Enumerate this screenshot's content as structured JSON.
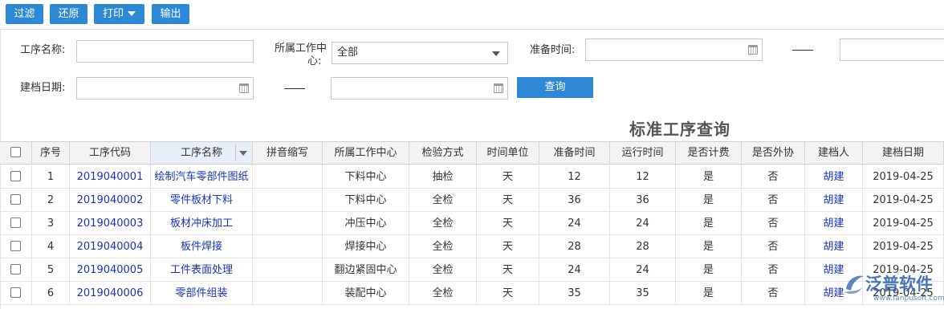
{
  "toolbar": {
    "filter": "过滤",
    "restore": "还原",
    "print": "打印",
    "export": "输出"
  },
  "filters": {
    "process_name_label": "工序名称:",
    "process_name_value": "",
    "work_center_label_1": "所属工作中",
    "work_center_label_2": "心:",
    "work_center_value": "全部",
    "prep_time_label": "准备时间:",
    "file_date_label": "建档日期:",
    "query": "查询"
  },
  "title": "标准工序查询",
  "table": {
    "headers": [
      "序号",
      "工序代码",
      "工序名称",
      "拼音缩写",
      "所属工作中心",
      "检验方式",
      "时间单位",
      "准备时间",
      "运行时间",
      "是否计费",
      "是否外协",
      "建档人",
      "建档日期"
    ],
    "rows": [
      {
        "no": "1",
        "code": "2019040001",
        "name": "绘制汽车零部件图纸",
        "abbr": "",
        "center": "下料中心",
        "inspect": "抽检",
        "unit": "天",
        "prep": "12",
        "run": "12",
        "billing": "是",
        "outsource": "否",
        "creator": "胡建",
        "date": "2019-04-25"
      },
      {
        "no": "2",
        "code": "2019040002",
        "name": "零件板材下料",
        "abbr": "",
        "center": "下料中心",
        "inspect": "全检",
        "unit": "天",
        "prep": "36",
        "run": "36",
        "billing": "是",
        "outsource": "否",
        "creator": "胡建",
        "date": "2019-04-25"
      },
      {
        "no": "3",
        "code": "2019040003",
        "name": "板材冲床加工",
        "abbr": "",
        "center": "冲压中心",
        "inspect": "全检",
        "unit": "天",
        "prep": "24",
        "run": "24",
        "billing": "是",
        "outsource": "否",
        "creator": "胡建",
        "date": "2019-04-25"
      },
      {
        "no": "4",
        "code": "2019040004",
        "name": "板件焊接",
        "abbr": "",
        "center": "焊接中心",
        "inspect": "全检",
        "unit": "天",
        "prep": "28",
        "run": "28",
        "billing": "是",
        "outsource": "否",
        "creator": "胡建",
        "date": "2019-04-25"
      },
      {
        "no": "5",
        "code": "2019040005",
        "name": "工件表面处理",
        "abbr": "",
        "center": "翻边紧固中心",
        "inspect": "全检",
        "unit": "天",
        "prep": "24",
        "run": "24",
        "billing": "是",
        "outsource": "否",
        "creator": "胡建",
        "date": "2019-04-25"
      },
      {
        "no": "6",
        "code": "2019040006",
        "name": "零部件组装",
        "abbr": "",
        "center": "装配中心",
        "inspect": "全检",
        "unit": "天",
        "prep": "35",
        "run": "35",
        "billing": "是",
        "outsource": "否",
        "creator": "胡建",
        "date": "2019-04-25"
      }
    ]
  },
  "watermark": {
    "text": "泛普软件",
    "url": "www.fanpusoft.com"
  },
  "colors": {
    "accent": "#2d89d6",
    "link": "#1a33b8"
  }
}
